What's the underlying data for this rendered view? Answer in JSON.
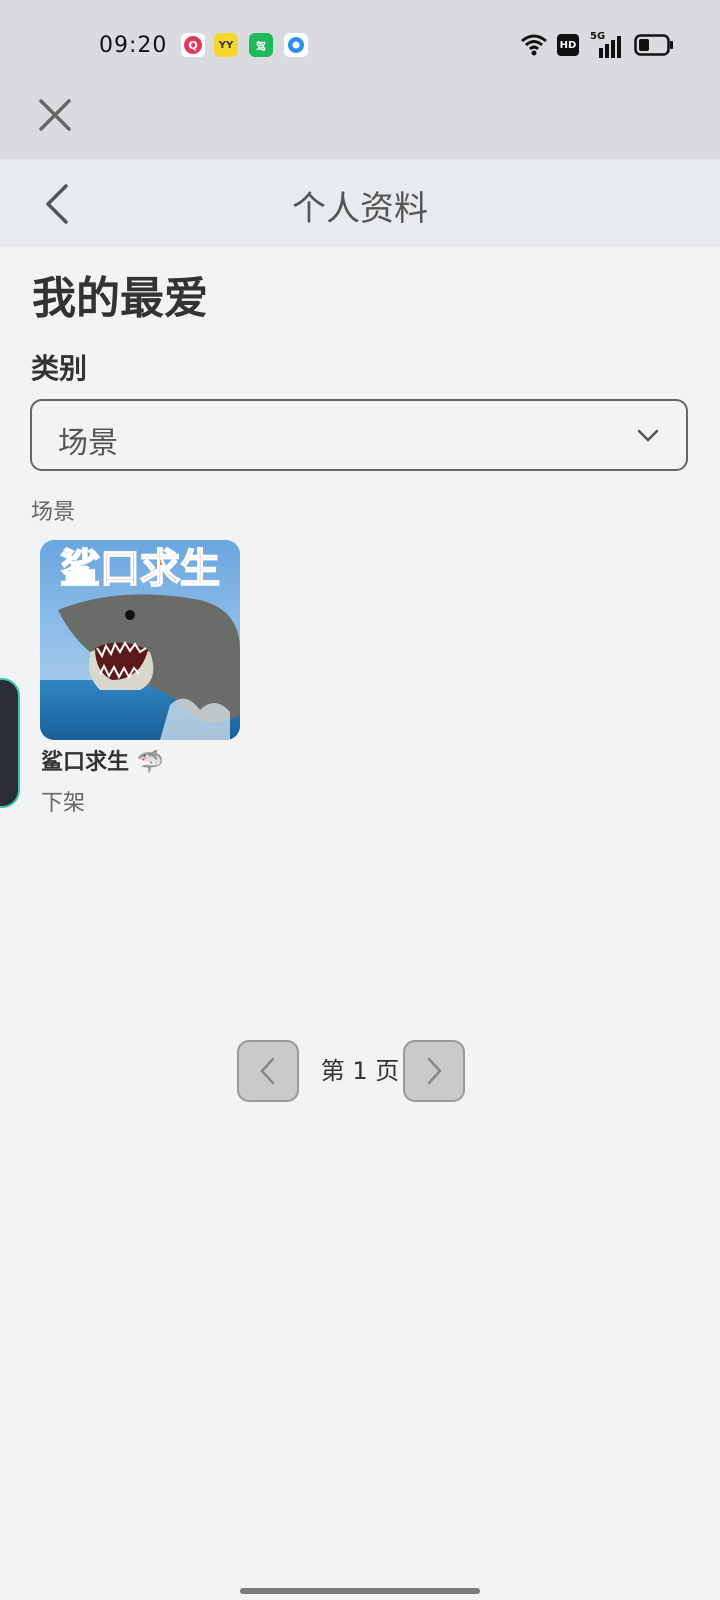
{
  "status": {
    "time": "09:20",
    "signal_label": "5G",
    "hd_label": "HD"
  },
  "notification_icons": [
    {
      "name": "app-notification-icon-1",
      "text": "Q",
      "color": "#e23a5f"
    },
    {
      "name": "app-notification-icon-2",
      "text": "YY",
      "color": "#f5d62e"
    },
    {
      "name": "app-notification-icon-3",
      "text": "驾",
      "color": "#1fb85b"
    },
    {
      "name": "app-notification-icon-4",
      "text": "",
      "color": "#2b8ff0"
    }
  ],
  "nav": {
    "title": "个人资料"
  },
  "page": {
    "heading": "我的最爱",
    "category_label": "类别"
  },
  "select": {
    "value": "场景"
  },
  "section": {
    "label": "场景"
  },
  "items": [
    {
      "thumbnail_text": "鲨口求生",
      "title": "鲨口求生 🦈",
      "status": "下架"
    }
  ],
  "pagination": {
    "label": "第 1 页"
  },
  "colors": {
    "accent_teal": "#33c9a2",
    "background": "#f2f3f5"
  }
}
